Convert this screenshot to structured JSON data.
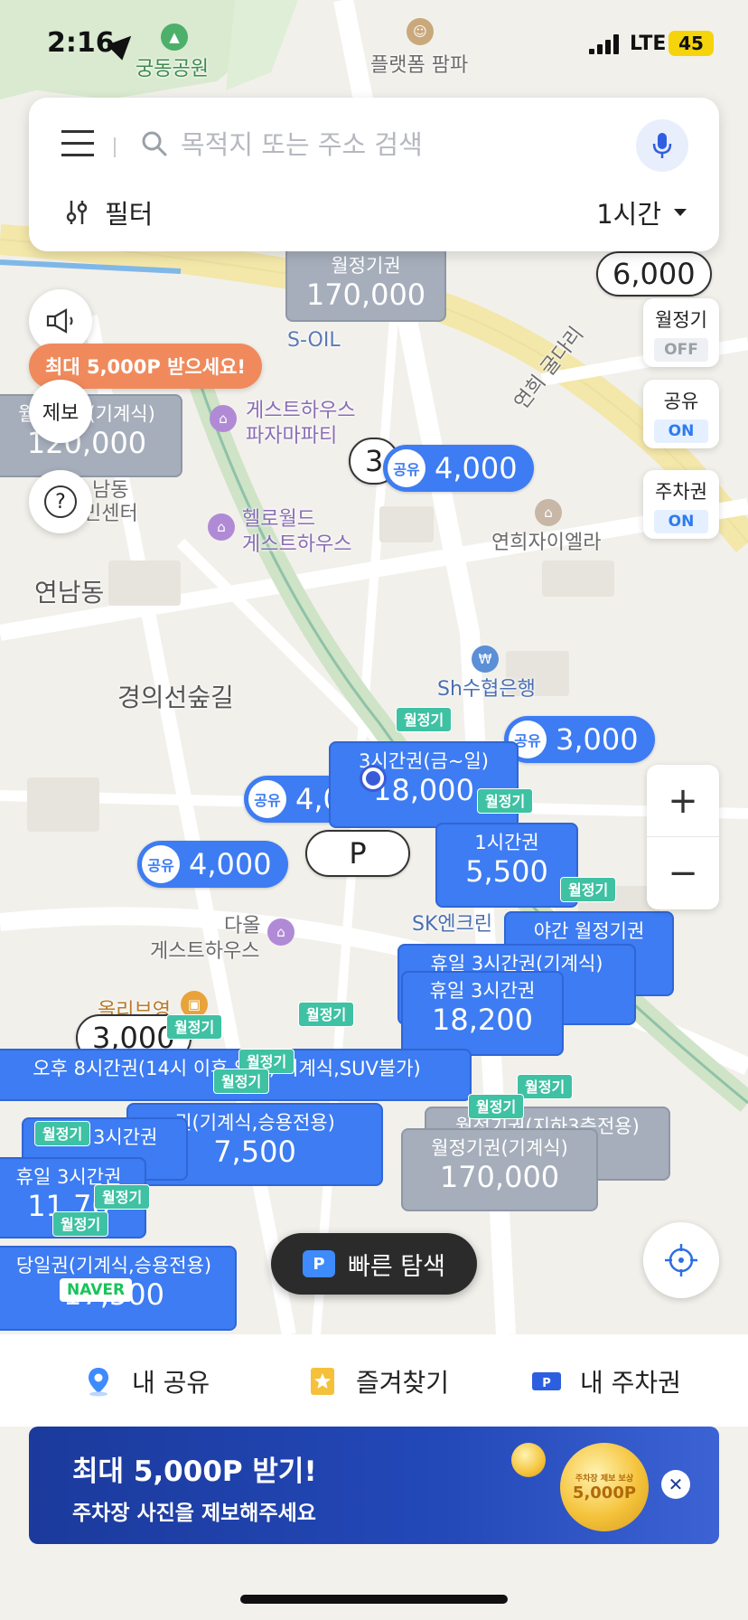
{
  "status_bar": {
    "time": "2:16",
    "network": "LTE",
    "battery": "45"
  },
  "search": {
    "placeholder": "목적지 또는 주소 검색",
    "filter_label": "필터",
    "duration": "1시간"
  },
  "map_labels": {
    "park": "궁동공원",
    "platform": "플랫폼 팜파",
    "soil": "S-OIL",
    "guesthouse1": "게스트하우스",
    "guesthouse1b": "파자마파티",
    "hello1": "헬로월드",
    "hello2": "게스트하우스",
    "yeonnam": "연남동",
    "gyeongui": "경의선숲길",
    "yeonhui_apt": "연희자이엘라",
    "bridge": "연희 굴다리",
    "sh": "Sh수협은행",
    "sk": "SK엔크린",
    "dale1": "다올",
    "dale2": "게스트하우스",
    "olive": "올리브영",
    "nam1": "남동",
    "nam2": "민센터"
  },
  "left_controls": {
    "promo": "최대 5,000P 받으세요!",
    "report": "제보",
    "help": "?"
  },
  "toggles": [
    {
      "label": "월정기",
      "state": "OFF"
    },
    {
      "label": "공유",
      "state": "ON"
    },
    {
      "label": "주차권",
      "state": "ON"
    }
  ],
  "markers": {
    "m_wol1_title": "월정기권",
    "m_wol1_price": "170,000",
    "m_left_title": "월정기권(기계식)",
    "m_left_price": "120,000",
    "m_3h_title": "3시간권(금~일)",
    "m_3h_price": "18,000",
    "m_1h_title": "1시간권",
    "m_1h_price": "5,500",
    "m_night_title": "야간 월정기권",
    "m_holiday3_title": "휴일 3시간권(기계식)",
    "m_holiday3b_title": "휴일 3시간권",
    "m_holiday3b_price": "18,200",
    "m_8h_title": "오후 8시간권(14시 이후 입차, 기계식,SUV불가)",
    "m_car_title": "권(기계식,승용전용)",
    "m_car_price": "7,500",
    "m_h3left_title": "휴일 3시간권",
    "m_h3left2_title": "휴일 3시간권",
    "m_h3left2_price": "11,70",
    "m_day_title": "당일권(기계식,승용전용)",
    "m_day_price": "17,500",
    "m_wol2_title": "월정기권(기계식)",
    "m_wol2_price": "170,000",
    "m_gray_title": "월정기권(지하3층전용)"
  },
  "pills": {
    "p_share_4000a": "4,000",
    "p_share_3000": "3,000",
    "p_share_4000b": "4,000",
    "p_share_4a": "4,0",
    "p_6000": "6,000",
    "p_3000": "3,000",
    "p_P": "P",
    "p_3": "3"
  },
  "share_label": "공유",
  "monthly_tag": "월정기",
  "quick_search": {
    "badge": "P",
    "label": "빠른 탐색"
  },
  "naver": "NAVER",
  "bottom_nav": [
    {
      "label": "내 공유"
    },
    {
      "label": "즐겨찾기"
    },
    {
      "label": "내 주차권"
    }
  ],
  "banner": {
    "title": "최대 5,000P 받기!",
    "subtitle": "주차장 사진을 제보해주세요",
    "coin_small": "주차장 제보 보상",
    "coin_value": "5,000P"
  },
  "colors": {
    "accent": "#3d7cf2",
    "monthly_tag": "#3fc1a3",
    "promo": "#f08a5c",
    "banner": "#1b3a9c"
  }
}
